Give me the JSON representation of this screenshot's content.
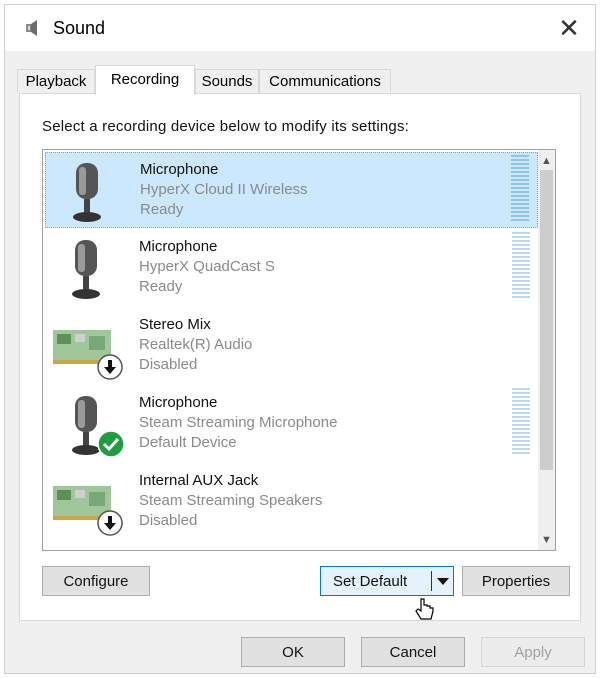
{
  "window": {
    "title": "Sound",
    "close_glyph": "✕",
    "icon": "speaker-icon"
  },
  "tabs": [
    {
      "label": "Playback",
      "active": false
    },
    {
      "label": "Recording",
      "active": true
    },
    {
      "label": "Sounds",
      "active": false
    },
    {
      "label": "Communications",
      "active": false
    }
  ],
  "instruction": "Select a recording device below to modify its settings:",
  "devices": [
    {
      "name": "Microphone",
      "description": "HyperX Cloud II Wireless",
      "status": "Ready",
      "icon": "microphone-icon",
      "selected": true,
      "has_level": true
    },
    {
      "name": "Microphone",
      "description": "HyperX QuadCast S",
      "status": "Ready",
      "icon": "microphone-icon",
      "selected": false,
      "has_level": true
    },
    {
      "name": "Stereo Mix",
      "description": "Realtek(R) Audio",
      "status": "Disabled",
      "icon": "sound-card-icon",
      "badge": "disabled-arrow-icon",
      "selected": false,
      "has_level": false
    },
    {
      "name": "Microphone",
      "description": "Steam Streaming Microphone",
      "status": "Default Device",
      "icon": "microphone-icon",
      "badge": "default-check-icon",
      "selected": false,
      "has_level": true
    },
    {
      "name": "Internal AUX Jack",
      "description": "Steam Streaming Speakers",
      "status": "Disabled",
      "icon": "sound-card-icon",
      "badge": "disabled-arrow-icon",
      "selected": false,
      "has_level": false
    }
  ],
  "buttons": {
    "configure": "Configure",
    "set_default": "Set Default",
    "properties": "Properties",
    "ok": "OK",
    "cancel": "Cancel",
    "apply": "Apply"
  },
  "colors": {
    "selection": "#cce8ff",
    "default_check": "#1e9e3e",
    "level_meter": "#b9d9ec"
  }
}
